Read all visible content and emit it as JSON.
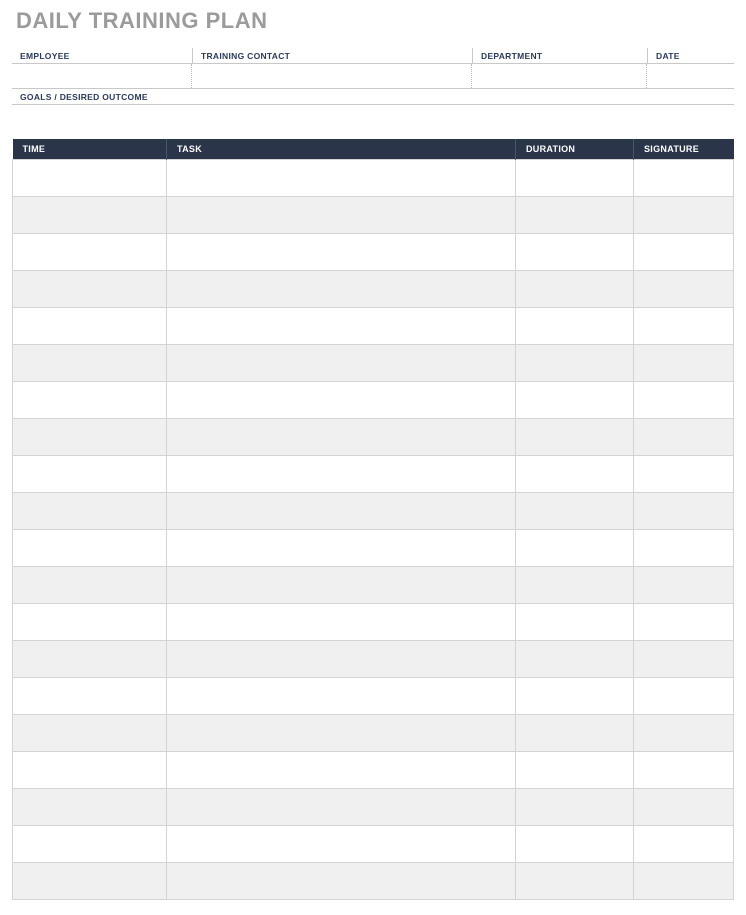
{
  "title": "DAILY TRAINING PLAN",
  "info": {
    "headers": {
      "employee": "EMPLOYEE",
      "contact": "TRAINING CONTACT",
      "department": "DEPARTMENT",
      "date": "DATE"
    },
    "values": {
      "employee": "",
      "contact": "",
      "department": "",
      "date": ""
    },
    "goals_header": "GOALS / DESIRED OUTCOME",
    "goals_value": ""
  },
  "table": {
    "headers": {
      "time": "TIME",
      "task": "TASK",
      "duration": "DURATION",
      "signature": "SIGNATURE"
    },
    "rows": [
      {
        "time": "",
        "task": "",
        "duration": "",
        "signature": ""
      },
      {
        "time": "",
        "task": "",
        "duration": "",
        "signature": ""
      },
      {
        "time": "",
        "task": "",
        "duration": "",
        "signature": ""
      },
      {
        "time": "",
        "task": "",
        "duration": "",
        "signature": ""
      },
      {
        "time": "",
        "task": "",
        "duration": "",
        "signature": ""
      },
      {
        "time": "",
        "task": "",
        "duration": "",
        "signature": ""
      },
      {
        "time": "",
        "task": "",
        "duration": "",
        "signature": ""
      },
      {
        "time": "",
        "task": "",
        "duration": "",
        "signature": ""
      },
      {
        "time": "",
        "task": "",
        "duration": "",
        "signature": ""
      },
      {
        "time": "",
        "task": "",
        "duration": "",
        "signature": ""
      },
      {
        "time": "",
        "task": "",
        "duration": "",
        "signature": ""
      },
      {
        "time": "",
        "task": "",
        "duration": "",
        "signature": ""
      },
      {
        "time": "",
        "task": "",
        "duration": "",
        "signature": ""
      },
      {
        "time": "",
        "task": "",
        "duration": "",
        "signature": ""
      },
      {
        "time": "",
        "task": "",
        "duration": "",
        "signature": ""
      },
      {
        "time": "",
        "task": "",
        "duration": "",
        "signature": ""
      },
      {
        "time": "",
        "task": "",
        "duration": "",
        "signature": ""
      },
      {
        "time": "",
        "task": "",
        "duration": "",
        "signature": ""
      },
      {
        "time": "",
        "task": "",
        "duration": "",
        "signature": ""
      },
      {
        "time": "",
        "task": "",
        "duration": "",
        "signature": ""
      }
    ]
  }
}
